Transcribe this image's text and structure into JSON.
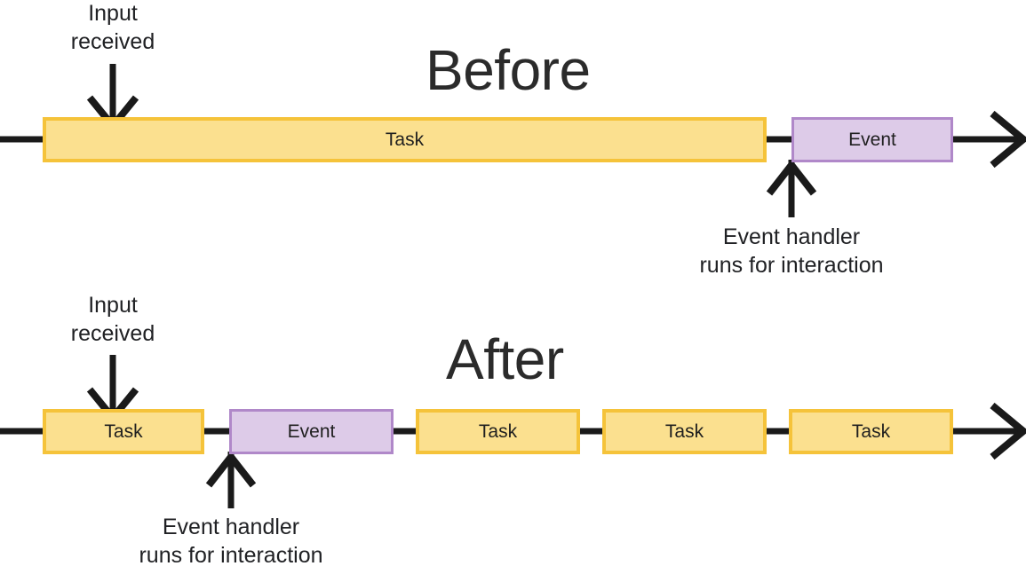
{
  "diagram": {
    "title_before": "Before",
    "title_after": "After",
    "labels": {
      "input_received": "Input\nreceived",
      "event_handler": "Event handler\nruns for interaction"
    },
    "colors": {
      "task_fill": "#fbe08f",
      "task_border": "#f5c33a",
      "event_fill": "#ddcbe8",
      "event_border": "#b088c9",
      "line": "#1a1a1a",
      "text": "#202124"
    },
    "before": {
      "blocks": [
        {
          "label": "Task",
          "type": "task"
        },
        {
          "label": "Event",
          "type": "event"
        }
      ],
      "input_annotation": "Input\nreceived",
      "handler_annotation": "Event handler\nruns for interaction"
    },
    "after": {
      "blocks": [
        {
          "label": "Task",
          "type": "task"
        },
        {
          "label": "Event",
          "type": "event"
        },
        {
          "label": "Task",
          "type": "task"
        },
        {
          "label": "Task",
          "type": "task"
        },
        {
          "label": "Task",
          "type": "task"
        }
      ],
      "input_annotation": "Input\nreceived",
      "handler_annotation": "Event handler\nruns for interaction"
    }
  }
}
